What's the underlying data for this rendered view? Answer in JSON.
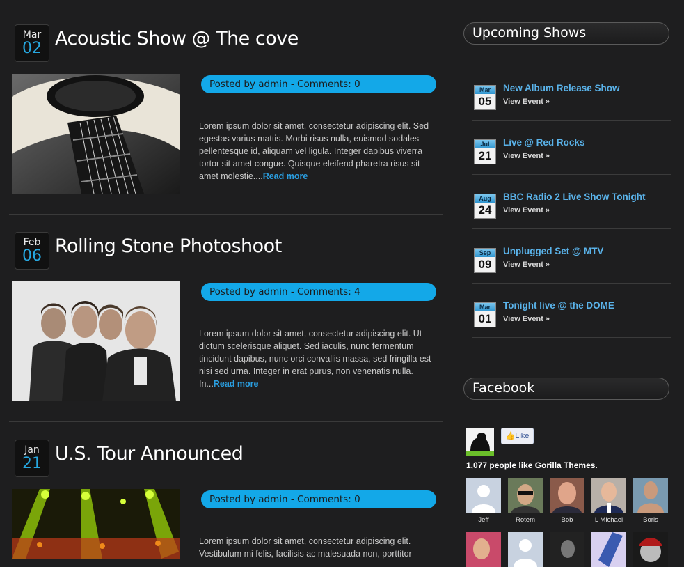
{
  "posts": [
    {
      "month": "Mar",
      "day": "02",
      "title": "Acoustic Show @ The cove",
      "meta_prefix": "Posted by ",
      "author": "admin",
      "meta_sep": " - Comments: ",
      "comments": "0",
      "excerpt": "Lorem ipsum dolor sit amet, consectetur adipiscing elit. Sed egestas varius mattis. Morbi risus nulla, euismod sodales pellentesque id, aliquam vel ligula. Integer dapibus viverra tortor sit amet congue. Quisque eleifend pharetra risus sit amet molestie....",
      "read_more": "Read more"
    },
    {
      "month": "Feb",
      "day": "06",
      "title": "Rolling Stone Photoshoot",
      "meta_prefix": "Posted by ",
      "author": "admin",
      "meta_sep": " - Comments: ",
      "comments": "4",
      "excerpt": "Lorem ipsum dolor sit amet, consectetur adipiscing elit. Ut dictum scelerisque aliquet. Sed iaculis, nunc fermentum tincidunt dapibus, nunc orci convallis massa, sed fringilla est nisi sed urna. Integer in erat purus, non venenatis nulla. In...",
      "read_more": "Read more"
    },
    {
      "month": "Jan",
      "day": "21",
      "title": "U.S. Tour Announced",
      "meta_prefix": "Posted by ",
      "author": "admin",
      "meta_sep": " - Comments: ",
      "comments": "0",
      "excerpt": "Lorem ipsum dolor sit amet, consectetur adipiscing elit. Vestibulum mi felis, facilisis ac malesuada non, porttitor",
      "read_more": ""
    }
  ],
  "sidebar": {
    "upcoming_title": "Upcoming Shows",
    "shows": [
      {
        "month": "Mar",
        "day": "05",
        "title": "New Album Release Show",
        "view": "View Event »"
      },
      {
        "month": "Jul",
        "day": "21",
        "title": "Live @ Red Rocks",
        "view": "View Event »"
      },
      {
        "month": "Aug",
        "day": "24",
        "title": "BBC Radio 2 Live Show Tonight",
        "view": "View Event »"
      },
      {
        "month": "Sep",
        "day": "09",
        "title": "Unplugged Set @ MTV",
        "view": "View Event »"
      },
      {
        "month": "Mar",
        "day": "01",
        "title": "Tonight live @ the DOME",
        "view": "View Event »"
      }
    ],
    "facebook_title": "Facebook",
    "like_label": "Like",
    "like_count_text": "1,077 people like ",
    "page_name": "Gorilla Themes",
    "fans": [
      "Jeff",
      "Rotem",
      "Bob",
      "L Michael",
      "Boris"
    ]
  },
  "colors": {
    "accent": "#13a8e8",
    "link": "#5ab3ea",
    "background": "#1e1e1f"
  }
}
